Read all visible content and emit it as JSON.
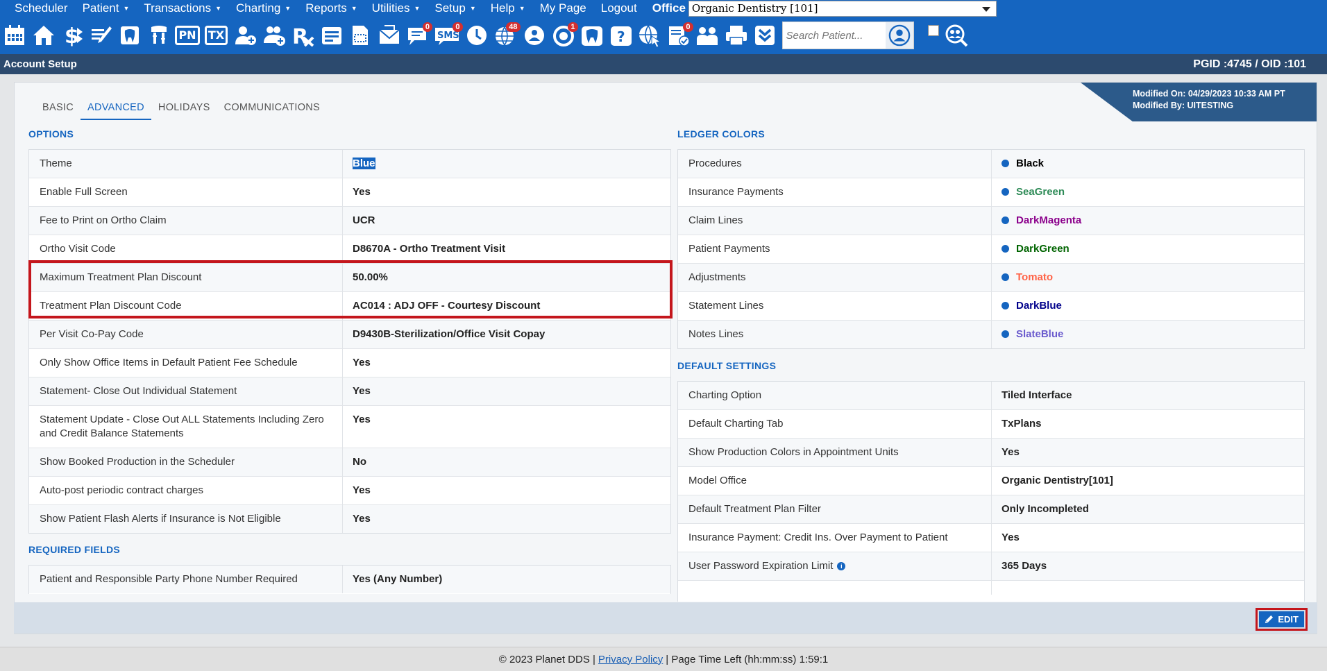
{
  "menu": {
    "items": [
      {
        "label": "Scheduler",
        "caret": false
      },
      {
        "label": "Patient",
        "caret": true
      },
      {
        "label": "Transactions",
        "caret": true
      },
      {
        "label": "Charting",
        "caret": true
      },
      {
        "label": "Reports",
        "caret": true
      },
      {
        "label": "Utilities",
        "caret": true
      },
      {
        "label": "Setup",
        "caret": true
      },
      {
        "label": "Help",
        "caret": true
      },
      {
        "label": "My Page",
        "caret": false
      },
      {
        "label": "Logout",
        "caret": false
      }
    ],
    "office_label": "Office",
    "office_value": "Organic Dentistry [101]"
  },
  "toolbar": {
    "pn_label": "PN",
    "tx_label": "TX",
    "sms_label": "SMS",
    "badge_messages": "0",
    "badge_sms": "0",
    "badge_web": "48",
    "badge_sync": "1",
    "badge_forms": "0",
    "search_placeholder": "Search Patient..."
  },
  "titlebar": {
    "title": "Account Setup",
    "ids": "PGID :4745  /  OID :101"
  },
  "tabs": [
    "BASIC",
    "ADVANCED",
    "HOLIDAYS",
    "COMMUNICATIONS"
  ],
  "modified": {
    "on": "Modified On: 04/29/2023 10:33 AM PT",
    "by": "Modified By: UITESTING"
  },
  "options": {
    "title": "OPTIONS",
    "rows": [
      {
        "key": "Theme",
        "value": "Blue"
      },
      {
        "key": "Enable Full Screen",
        "value": "Yes"
      },
      {
        "key": "Fee to Print on Ortho Claim",
        "value": "UCR"
      },
      {
        "key": "Ortho Visit Code",
        "value": "D8670A - Ortho Treatment Visit"
      },
      {
        "key": "Maximum Treatment Plan Discount",
        "value": "50.00%"
      },
      {
        "key": "Treatment Plan Discount Code",
        "value": "AC014 : ADJ OFF - Courtesy Discount"
      },
      {
        "key": "Per Visit Co-Pay Code",
        "value": "D9430B-Sterilization/Office Visit Copay"
      },
      {
        "key": "Only Show Office Items in Default Patient Fee Schedule",
        "value": "Yes"
      },
      {
        "key": "Statement- Close Out Individual Statement",
        "value": "Yes"
      },
      {
        "key": "Statement Update - Close Out ALL Statements Including Zero and Credit Balance Statements",
        "value": "Yes"
      },
      {
        "key": "Show Booked Production in the Scheduler",
        "value": "No"
      },
      {
        "key": "Auto-post periodic contract charges",
        "value": "Yes"
      },
      {
        "key": "Show Patient Flash Alerts if Insurance is Not Eligible",
        "value": "Yes"
      }
    ]
  },
  "required_fields": {
    "title": "REQUIRED FIELDS",
    "rows": [
      {
        "key": "Patient and Responsible Party Phone Number Required",
        "value": "Yes (Any Number)"
      }
    ]
  },
  "ledger_colors": {
    "title": "LEDGER COLORS",
    "rows": [
      {
        "key": "Procedures",
        "value": "Black",
        "color": "#000000"
      },
      {
        "key": "Insurance Payments",
        "value": "SeaGreen",
        "color": "#2e8b57"
      },
      {
        "key": "Claim Lines",
        "value": "DarkMagenta",
        "color": "#8b008b"
      },
      {
        "key": "Patient Payments",
        "value": "DarkGreen",
        "color": "#006400"
      },
      {
        "key": "Adjustments",
        "value": "Tomato",
        "color": "#ff6347"
      },
      {
        "key": "Statement Lines",
        "value": "DarkBlue",
        "color": "#00008b"
      },
      {
        "key": "Notes Lines",
        "value": "SlateBlue",
        "color": "#6a5acd"
      }
    ]
  },
  "default_settings": {
    "title": "DEFAULT SETTINGS",
    "rows": [
      {
        "key": "Charting Option",
        "value": "Tiled Interface"
      },
      {
        "key": "Default Charting Tab",
        "value": "TxPlans"
      },
      {
        "key": "Show Production Colors in Appointment Units",
        "value": "Yes"
      },
      {
        "key": "Model Office",
        "value": "Organic Dentistry[101]"
      },
      {
        "key": "Default Treatment Plan Filter",
        "value": "Only Incompleted"
      },
      {
        "key": "Insurance Payment: Credit Ins. Over Payment to Patient",
        "value": "Yes"
      },
      {
        "key": "User Password Expiration Limit",
        "value": "365 Days"
      }
    ]
  },
  "edit_label": "EDIT",
  "footer": {
    "copyright": "© 2023 Planet DDS |",
    "privacy": "Privacy Policy",
    "time_left": "|  Page Time Left (hh:mm:ss) 1:59:1"
  },
  "colors": {
    "brand_blue": "#1565c0",
    "title_bar": "#2c4a6e",
    "highlight_red": "#c4161c"
  }
}
